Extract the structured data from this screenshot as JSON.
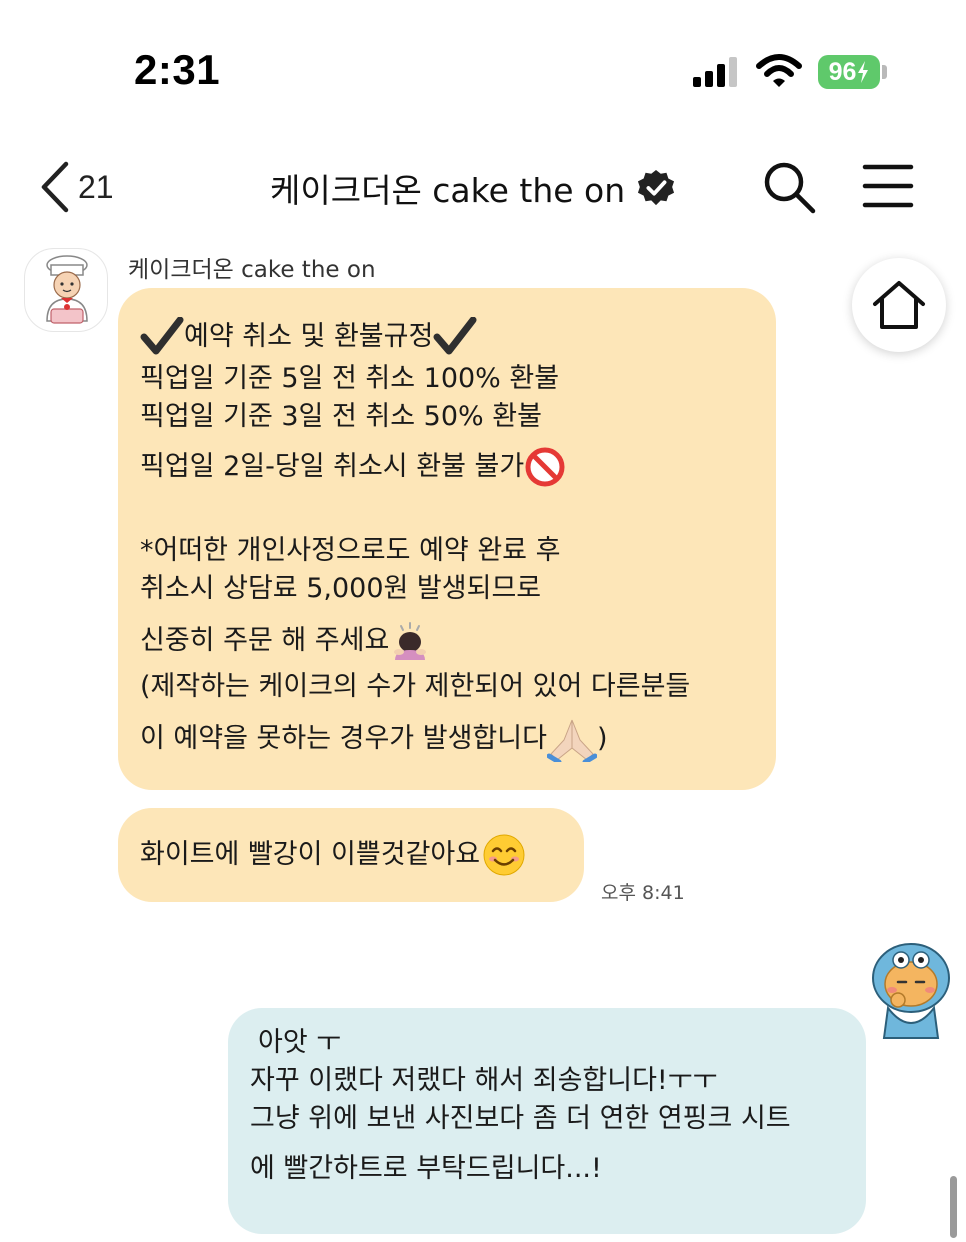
{
  "status_bar": {
    "time": "2:31",
    "battery": "96"
  },
  "header": {
    "back_count": "21",
    "title": "케이크더온 cake the on"
  },
  "chat": {
    "sender_name": "케이크더온 cake the on",
    "messages": [
      {
        "lines": [
          "예약 취소 및 환불규정",
          "픽업일 기준 5일 전 취소 100% 환불",
          "픽업일 기준 3일 전 취소 50% 환불",
          "픽업일 2일-당일 취소시 환불 불가",
          "*어떠한 개인사정으로도 예약 완료 후",
          "취소시 상담료 5,000원 발생되므로",
          "신중히 주문 해 주세요",
          "(제작하는 케이크의 수가 제한되어 있어 다른분들",
          "이 예약을 못하는 경우가 발생합니다",
          ")"
        ]
      },
      {
        "text": "화이트에 빨강이 이쁠것같아요",
        "time": "오후 8:41"
      }
    ],
    "my_message": {
      "lines": [
        "아앗 ㅜ",
        "자꾸 이랬다 저랬다 해서 죄송합니다!ㅜㅜ",
        "그냥 위에 보낸 사진보다 좀 더 연한 연핑크 시트",
        "에 빨간하트로 부탁드립니다...!"
      ]
    }
  },
  "colors": {
    "partner_bubble": "#fde6b8",
    "my_bubble": "#dceef0",
    "battery": "#5fc96b"
  }
}
